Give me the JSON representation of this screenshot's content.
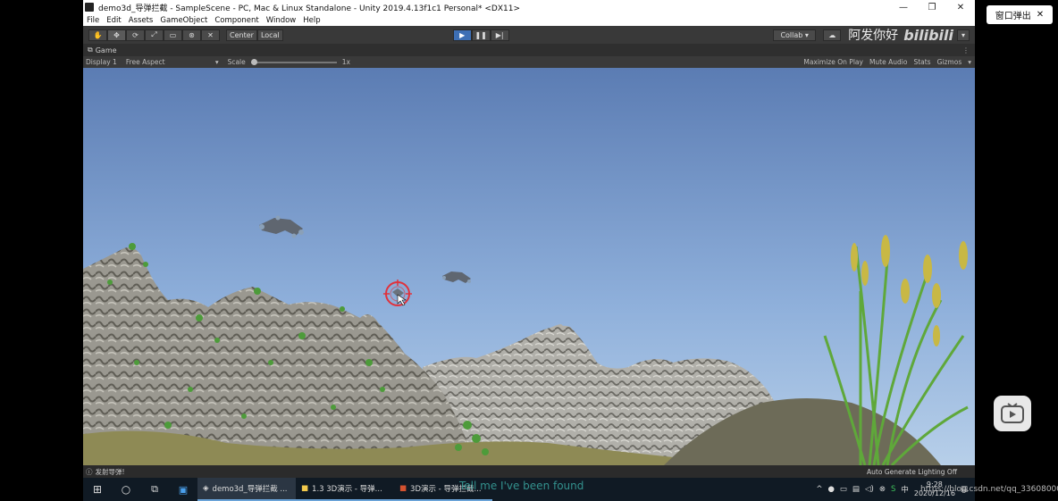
{
  "window": {
    "title": "demo3d_导弹拦截 - SampleScene - PC, Mac & Linux Standalone - Unity 2019.4.13f1c1 Personal* <DX11>",
    "controls": [
      "—",
      "❐",
      "✕"
    ]
  },
  "menu": [
    "File",
    "Edit",
    "Assets",
    "GameObject",
    "Component",
    "Window",
    "Help"
  ],
  "toolbar": {
    "tools": [
      "✋",
      "✥",
      "⟳",
      "⤢",
      "▭",
      "⊛",
      "✕"
    ],
    "pivot": "Center",
    "space": "Local",
    "play_controls": [
      "▶",
      "❚❚",
      "▶|"
    ],
    "collab": "Collab ▾",
    "account_hint": "阿发你好"
  },
  "game_tab": {
    "label": "Game"
  },
  "game_bar": {
    "display": "Display 1",
    "aspect": "Free Aspect",
    "scale_label": "Scale",
    "scale_value": "1x",
    "scale_level": 0.0,
    "right": [
      "Maximize On Play",
      "Mute Audio",
      "Stats",
      "Gizmos"
    ]
  },
  "status": {
    "left": "发射导弹!",
    "right": "Auto Generate Lighting Off"
  },
  "popup": {
    "label": "窗口弹出",
    "close": "✕"
  },
  "taskbar": {
    "apps": [
      {
        "label": "demo3d_导弹拦截 ..."
      },
      {
        "label": "1.3 3D演示 - 导弹..."
      },
      {
        "label": "3D演示 - 导弹拦截..."
      }
    ],
    "time": "9:28",
    "date": "2020/12/16"
  },
  "subtitle": "Tell me I've been found",
  "watermark": "https://blog.csdn.net/qq_33608000",
  "colors": {
    "sky_top": "#5c7fb6",
    "sky_bottom": "#a9c6e6",
    "play_active": "#3d6fb5",
    "reticle": "#e0323c"
  }
}
